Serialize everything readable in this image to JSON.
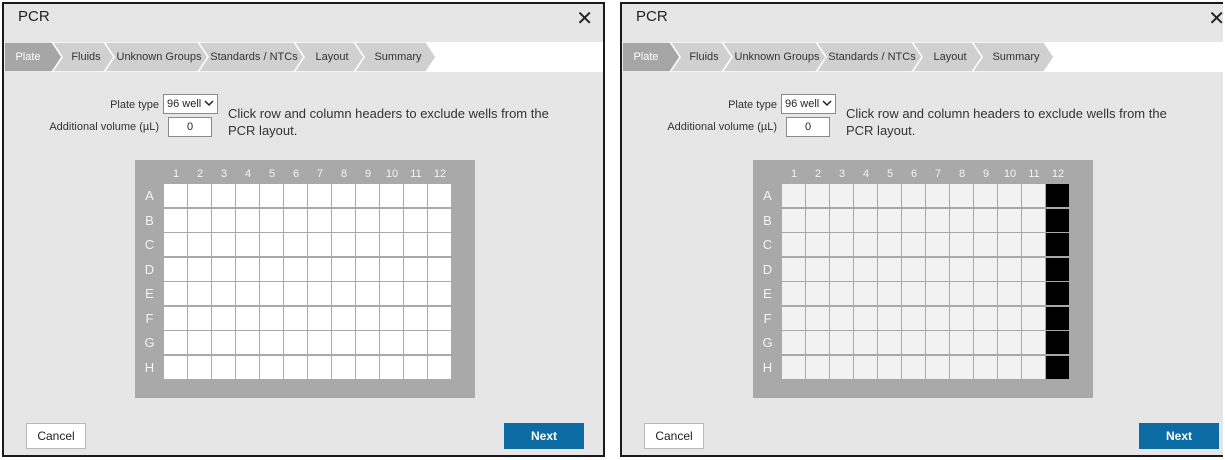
{
  "dialogs": [
    {
      "title": "PCR",
      "close_glyph": "✕",
      "tabs": [
        {
          "label": "Plate",
          "active": true
        },
        {
          "label": "Fluids",
          "active": false
        },
        {
          "label": "Unknown Groups",
          "active": false
        },
        {
          "label": "Standards / NTCs",
          "active": false
        },
        {
          "label": "Layout",
          "active": false
        },
        {
          "label": "Summary",
          "active": false
        }
      ],
      "plate_type_label": "Plate type",
      "plate_type_value": "96 well",
      "additional_volume_label": "Additional volume (µL)",
      "additional_volume_value": "0",
      "instructions": "Click row and column headers to exclude wells from the PCR layout.",
      "plate": {
        "columns": [
          "1",
          "2",
          "3",
          "4",
          "5",
          "6",
          "7",
          "8",
          "9",
          "10",
          "11",
          "12"
        ],
        "rows": [
          "A",
          "B",
          "C",
          "D",
          "E",
          "F",
          "G",
          "H"
        ],
        "excluded_columns": []
      },
      "cancel_label": "Cancel",
      "next_label": "Next"
    },
    {
      "title": "PCR",
      "close_glyph": "✕",
      "tabs": [
        {
          "label": "Plate",
          "active": true
        },
        {
          "label": "Fluids",
          "active": false
        },
        {
          "label": "Unknown Groups",
          "active": false
        },
        {
          "label": "Standards / NTCs",
          "active": false
        },
        {
          "label": "Layout",
          "active": false
        },
        {
          "label": "Summary",
          "active": false
        }
      ],
      "plate_type_label": "Plate type",
      "plate_type_value": "96 well",
      "additional_volume_label": "Additional volume (µL)",
      "additional_volume_value": "0",
      "instructions": "Click row and column headers to exclude wells from the PCR layout.",
      "plate": {
        "columns": [
          "1",
          "2",
          "3",
          "4",
          "5",
          "6",
          "7",
          "8",
          "9",
          "10",
          "11",
          "12"
        ],
        "rows": [
          "A",
          "B",
          "C",
          "D",
          "E",
          "F",
          "G",
          "H"
        ],
        "excluded_columns": [
          "12"
        ]
      },
      "cancel_label": "Cancel",
      "next_label": "Next"
    }
  ],
  "colors": {
    "dialog_bg": "#e6e6e6",
    "tab_active": "#a6a6a6",
    "tab_inactive": "#d0d0d0",
    "plate_bg": "#a9a9a9",
    "excluded_well": "#000000",
    "next_button": "#0c6da5"
  },
  "icons": {
    "close": "close-icon",
    "dropdown": "chevron-down-icon"
  }
}
